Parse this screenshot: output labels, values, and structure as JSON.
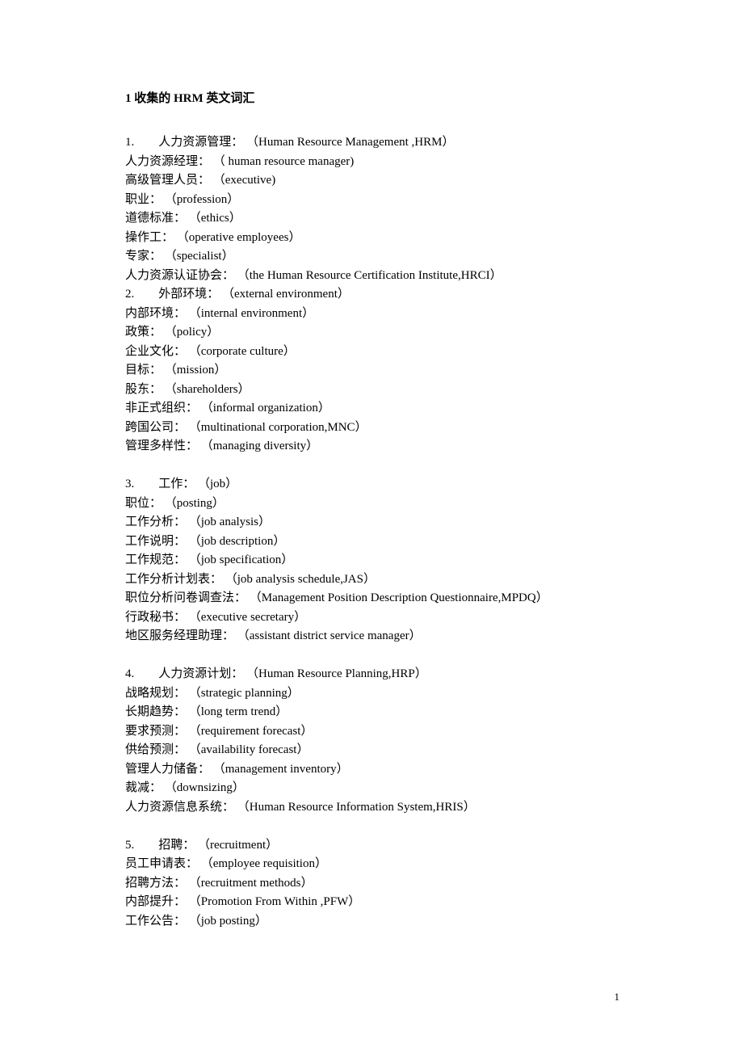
{
  "title": "1  收集的 HRM 英文词汇",
  "lines": [
    "1.        人力资源管理： （Human Resource Management ,HRM）",
    "人力资源经理： （ human resource manager)",
    "高级管理人员： （executive)",
    "职业： （profession）",
    "道德标准： （ethics）",
    "操作工： （operative employees）",
    "专家： （specialist）",
    "人力资源认证协会： （the Human Resource Certification Institute,HRCI）",
    "2.        外部环境： （external environment）",
    "内部环境： （internal environment）",
    "政策： （policy）",
    "企业文化： （corporate culture）",
    "目标： （mission）",
    "股东： （shareholders）",
    "非正式组织： （informal organization）",
    "跨国公司： （multinational corporation,MNC）",
    "管理多样性： （managing diversity）",
    "",
    "3.        工作： （job）",
    "职位： （posting）",
    "工作分析： （job analysis）",
    "工作说明： （job description）",
    "工作规范： （job specification）",
    "工作分析计划表： （job analysis schedule,JAS）",
    "职位分析问卷调查法： （Management Position Description Questionnaire,MPDQ）",
    "行政秘书： （executive secretary）",
    "地区服务经理助理： （assistant district service manager）",
    "",
    "4.        人力资源计划： （Human Resource Planning,HRP）",
    "战略规划： （strategic planning）",
    "长期趋势： （long term trend）",
    "要求预测： （requirement forecast）",
    "供给预测： （availability forecast）",
    "管理人力储备： （management inventory）",
    "裁减： （downsizing）",
    "人力资源信息系统： （Human Resource Information System,HRIS）",
    "",
    "5.        招聘： （recruitment）",
    "员工申请表： （employee requisition）",
    "招聘方法： （recruitment methods）",
    "内部提升： （Promotion From Within ,PFW）",
    "工作公告： （job posting）"
  ],
  "page_number": "1"
}
